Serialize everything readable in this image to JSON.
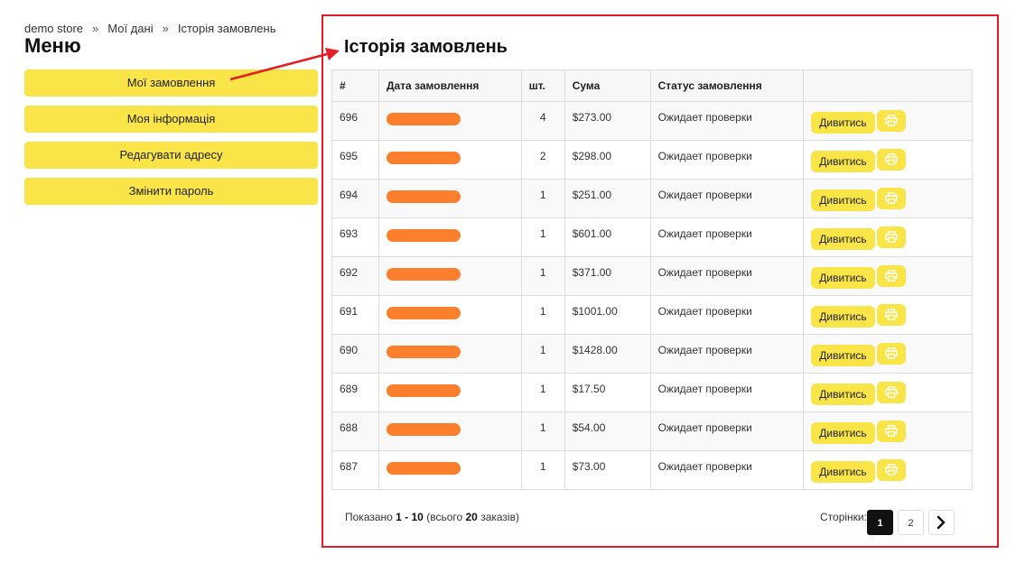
{
  "breadcrumb": {
    "items": [
      "demo store",
      "Мої дані",
      "Історія замовлень"
    ],
    "separator": "»"
  },
  "sidebar": {
    "title": "Меню",
    "items": [
      {
        "label": "Мої замовлення"
      },
      {
        "label": "Моя інформація"
      },
      {
        "label": "Редагувати адресу"
      },
      {
        "label": "Змінити пароль"
      }
    ]
  },
  "main": {
    "title": "Історія замовлень",
    "table": {
      "headers": [
        "#",
        "Дата замовлення",
        "шт.",
        "Сума",
        "Статус замовлення"
      ],
      "view_label": "Дивитись",
      "rows": [
        {
          "id": "696",
          "qty": "4",
          "sum": "$273.00",
          "status": "Ожидает проверки"
        },
        {
          "id": "695",
          "qty": "2",
          "sum": "$298.00",
          "status": "Ожидает проверки"
        },
        {
          "id": "694",
          "qty": "1",
          "sum": "$251.00",
          "status": "Ожидает проверки"
        },
        {
          "id": "693",
          "qty": "1",
          "sum": "$601.00",
          "status": "Ожидает проверки"
        },
        {
          "id": "692",
          "qty": "1",
          "sum": "$371.00",
          "status": "Ожидает проверки"
        },
        {
          "id": "691",
          "qty": "1",
          "sum": "$1001.00",
          "status": "Ожидает проверки"
        },
        {
          "id": "690",
          "qty": "1",
          "sum": "$1428.00",
          "status": "Ожидает проверки"
        },
        {
          "id": "689",
          "qty": "1",
          "sum": "$17.50",
          "status": "Ожидает проверки"
        },
        {
          "id": "688",
          "qty": "1",
          "sum": "$54.00",
          "status": "Ожидает проверки"
        },
        {
          "id": "687",
          "qty": "1",
          "sum": "$73.00",
          "status": "Ожидает проверки"
        }
      ]
    },
    "summary": {
      "prefix": "Показано",
      "range": "1 - 10",
      "middle": "(всього",
      "total": "20",
      "suffix": "заказів)"
    },
    "pagination": {
      "label": "Сторінки:",
      "pages": [
        "1",
        "2"
      ],
      "current": "1"
    }
  },
  "colors": {
    "accent": "#f9e547",
    "annotation": "#e31e24",
    "redaction": "#fb7f2d"
  },
  "icons": {
    "print": "print-icon",
    "next": "chevron-right-icon"
  }
}
